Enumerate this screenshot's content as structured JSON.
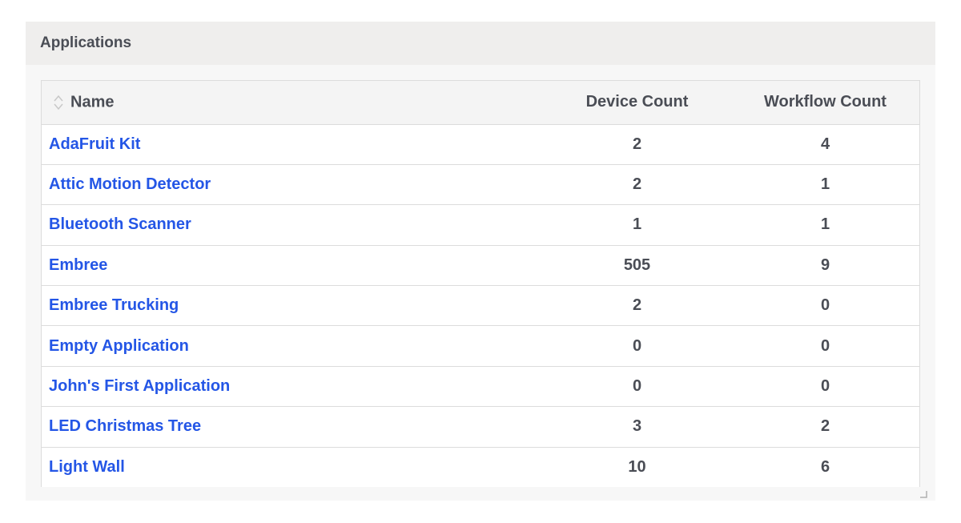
{
  "panel": {
    "title": "Applications"
  },
  "table": {
    "columns": {
      "name": "Name",
      "device_count": "Device Count",
      "workflow_count": "Workflow Count"
    },
    "rows": [
      {
        "name": "AdaFruit Kit",
        "device_count": "2",
        "workflow_count": "4"
      },
      {
        "name": "Attic Motion Detector",
        "device_count": "2",
        "workflow_count": "1"
      },
      {
        "name": "Bluetooth Scanner",
        "device_count": "1",
        "workflow_count": "1"
      },
      {
        "name": "Embree",
        "device_count": "505",
        "workflow_count": "9"
      },
      {
        "name": "Embree Trucking",
        "device_count": "2",
        "workflow_count": "0"
      },
      {
        "name": "Empty Application",
        "device_count": "0",
        "workflow_count": "0"
      },
      {
        "name": "John's First Application",
        "device_count": "0",
        "workflow_count": "0"
      },
      {
        "name": "LED Christmas Tree",
        "device_count": "3",
        "workflow_count": "2"
      },
      {
        "name": "Light Wall",
        "device_count": "10",
        "workflow_count": "6"
      }
    ]
  },
  "icons": {
    "sort": "sort-icon",
    "resize": "resize-handle-icon"
  },
  "colors": {
    "link": "#2456e6",
    "text": "#4a4d55",
    "header_bg": "#efeeed"
  }
}
